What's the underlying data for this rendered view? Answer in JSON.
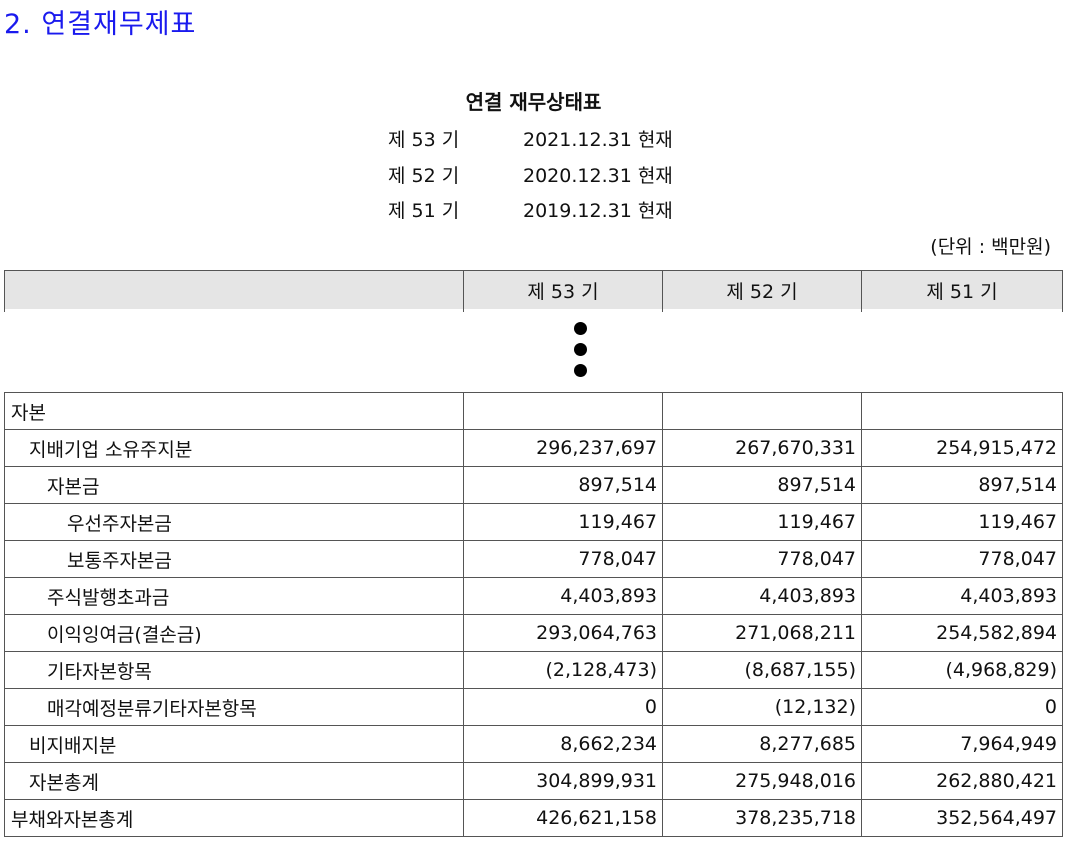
{
  "section_title": "2. 연결재무제표",
  "doc_title": "연결 재무상태표",
  "periods": [
    {
      "label": "제 53 기",
      "date": "2021.12.31 현재"
    },
    {
      "label": "제 52 기",
      "date": "2020.12.31 현재"
    },
    {
      "label": "제 51 기",
      "date": "2019.12.31 현재"
    }
  ],
  "unit": "(단위 : 백만원)",
  "columns": [
    "",
    "제 53 기",
    "제 52 기",
    "제 51 기"
  ],
  "rows": [
    {
      "label": "자본",
      "values": [
        "",
        "",
        ""
      ]
    },
    {
      "label": "지배기업 소유주지분",
      "values": [
        "296,237,697",
        "267,670,331",
        "254,915,472"
      ]
    },
    {
      "label": "자본금",
      "values": [
        "897,514",
        "897,514",
        "897,514"
      ]
    },
    {
      "label": "우선주자본금",
      "values": [
        "119,467",
        "119,467",
        "119,467"
      ]
    },
    {
      "label": "보통주자본금",
      "values": [
        "778,047",
        "778,047",
        "778,047"
      ]
    },
    {
      "label": "주식발행초과금",
      "values": [
        "4,403,893",
        "4,403,893",
        "4,403,893"
      ]
    },
    {
      "label": "이익잉여금(결손금)",
      "values": [
        "293,064,763",
        "271,068,211",
        "254,582,894"
      ]
    },
    {
      "label": "기타자본항목",
      "values": [
        "(2,128,473)",
        "(8,687,155)",
        "(4,968,829)"
      ]
    },
    {
      "label": "매각예정분류기타자본항목",
      "values": [
        "0",
        "(12,132)",
        "0"
      ]
    },
    {
      "label": "비지배지분",
      "values": [
        "8,662,234",
        "8,277,685",
        "7,964,949"
      ]
    },
    {
      "label": "자본총계",
      "values": [
        "304,899,931",
        "275,948,016",
        "262,880,421"
      ]
    },
    {
      "label": "부채와자본총계",
      "values": [
        "426,621,158",
        "378,235,718",
        "352,564,497"
      ]
    }
  ]
}
